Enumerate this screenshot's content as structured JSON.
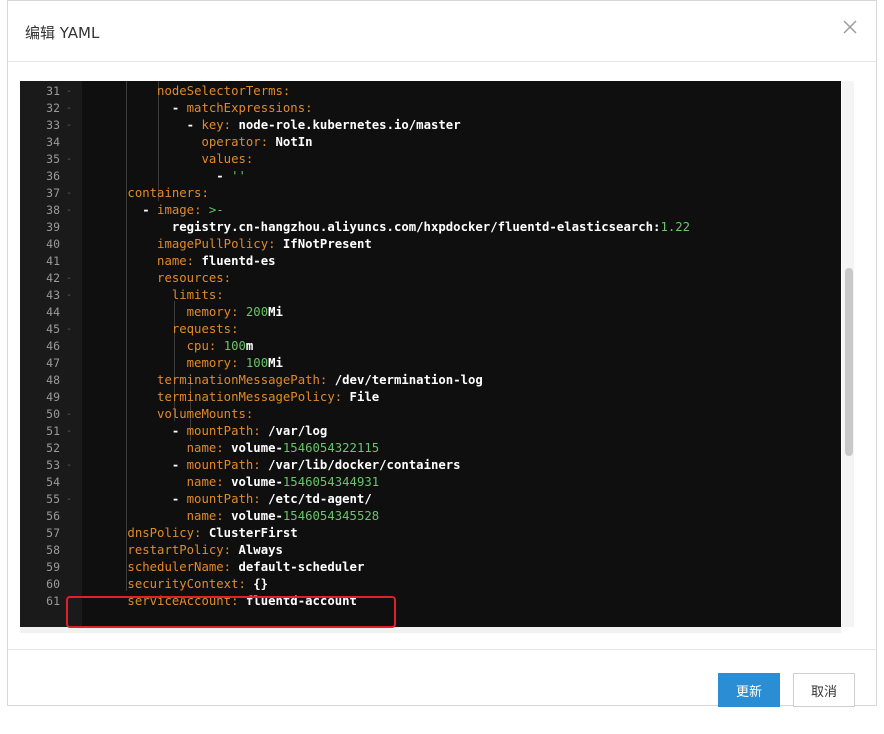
{
  "dialog": {
    "title": "编辑 YAML",
    "close_icon": "close-icon",
    "buttons": {
      "update": "更新",
      "cancel": "取消"
    }
  },
  "colors": {
    "key": "#e08a2a",
    "value": "#ffffff",
    "number": "#6ac46a",
    "primary": "#2b8ed4",
    "highlight": "#e0202a"
  },
  "editor": {
    "lines": [
      {
        "n": "31",
        "fold": true,
        "indent": "          ",
        "parts": [
          [
            "k",
            "nodeSelectorTerms:"
          ]
        ]
      },
      {
        "n": "32",
        "fold": true,
        "indent": "            ",
        "parts": [
          [
            "p",
            "- "
          ],
          [
            "k",
            "matchExpressions:"
          ]
        ]
      },
      {
        "n": "33",
        "fold": true,
        "indent": "              ",
        "parts": [
          [
            "p",
            "- "
          ],
          [
            "k",
            "key: "
          ],
          [
            "v",
            "node-role.kubernetes.io/master"
          ]
        ]
      },
      {
        "n": "34",
        "fold": false,
        "indent": "                ",
        "parts": [
          [
            "k",
            "operator: "
          ],
          [
            "v",
            "NotIn"
          ]
        ]
      },
      {
        "n": "35",
        "fold": true,
        "indent": "                ",
        "parts": [
          [
            "k",
            "values:"
          ]
        ]
      },
      {
        "n": "36",
        "fold": false,
        "indent": "                  ",
        "parts": [
          [
            "p",
            "- "
          ],
          [
            "n",
            "''"
          ]
        ]
      },
      {
        "n": "37",
        "fold": true,
        "indent": "      ",
        "parts": [
          [
            "k",
            "containers:"
          ]
        ]
      },
      {
        "n": "38",
        "fold": true,
        "indent": "        ",
        "parts": [
          [
            "p",
            "- "
          ],
          [
            "k",
            "image: "
          ],
          [
            "n",
            ">-"
          ]
        ]
      },
      {
        "n": "39",
        "fold": false,
        "indent": "            ",
        "parts": [
          [
            "v",
            "registry.cn-hangzhou.aliyuncs.com/hxpdocker/fluentd-elasticsearch:"
          ],
          [
            "n",
            "1.22"
          ]
        ]
      },
      {
        "n": "40",
        "fold": false,
        "indent": "          ",
        "parts": [
          [
            "k",
            "imagePullPolicy: "
          ],
          [
            "v",
            "IfNotPresent"
          ]
        ]
      },
      {
        "n": "41",
        "fold": false,
        "indent": "          ",
        "parts": [
          [
            "k",
            "name: "
          ],
          [
            "v",
            "fluentd-es"
          ]
        ]
      },
      {
        "n": "42",
        "fold": true,
        "indent": "          ",
        "parts": [
          [
            "k",
            "resources:"
          ]
        ]
      },
      {
        "n": "43",
        "fold": true,
        "indent": "            ",
        "parts": [
          [
            "k",
            "limits:"
          ]
        ]
      },
      {
        "n": "44",
        "fold": false,
        "indent": "              ",
        "parts": [
          [
            "k",
            "memory: "
          ],
          [
            "n",
            "200"
          ],
          [
            "v",
            "Mi"
          ]
        ]
      },
      {
        "n": "45",
        "fold": true,
        "indent": "            ",
        "parts": [
          [
            "k",
            "requests:"
          ]
        ]
      },
      {
        "n": "46",
        "fold": false,
        "indent": "              ",
        "parts": [
          [
            "k",
            "cpu: "
          ],
          [
            "n",
            "100"
          ],
          [
            "v",
            "m"
          ]
        ]
      },
      {
        "n": "47",
        "fold": false,
        "indent": "              ",
        "parts": [
          [
            "k",
            "memory: "
          ],
          [
            "n",
            "100"
          ],
          [
            "v",
            "Mi"
          ]
        ]
      },
      {
        "n": "48",
        "fold": false,
        "indent": "          ",
        "parts": [
          [
            "k",
            "terminationMessagePath: "
          ],
          [
            "v",
            "/dev/termination-log"
          ]
        ]
      },
      {
        "n": "49",
        "fold": false,
        "indent": "          ",
        "parts": [
          [
            "k",
            "terminationMessagePolicy: "
          ],
          [
            "v",
            "File"
          ]
        ]
      },
      {
        "n": "50",
        "fold": true,
        "indent": "          ",
        "parts": [
          [
            "k",
            "volumeMounts:"
          ]
        ]
      },
      {
        "n": "51",
        "fold": true,
        "indent": "            ",
        "parts": [
          [
            "p",
            "- "
          ],
          [
            "k",
            "mountPath: "
          ],
          [
            "v",
            "/var/log"
          ]
        ]
      },
      {
        "n": "52",
        "fold": false,
        "indent": "              ",
        "parts": [
          [
            "k",
            "name: "
          ],
          [
            "v",
            "volume-"
          ],
          [
            "n",
            "1546054322115"
          ]
        ]
      },
      {
        "n": "53",
        "fold": true,
        "indent": "            ",
        "parts": [
          [
            "p",
            "- "
          ],
          [
            "k",
            "mountPath: "
          ],
          [
            "v",
            "/var/lib/docker/containers"
          ]
        ]
      },
      {
        "n": "54",
        "fold": false,
        "indent": "              ",
        "parts": [
          [
            "k",
            "name: "
          ],
          [
            "v",
            "volume-"
          ],
          [
            "n",
            "1546054344931"
          ]
        ]
      },
      {
        "n": "55",
        "fold": true,
        "indent": "            ",
        "parts": [
          [
            "p",
            "- "
          ],
          [
            "k",
            "mountPath: "
          ],
          [
            "v",
            "/etc/td-agent/"
          ]
        ]
      },
      {
        "n": "56",
        "fold": false,
        "indent": "              ",
        "parts": [
          [
            "k",
            "name: "
          ],
          [
            "v",
            "volume-"
          ],
          [
            "n",
            "1546054345528"
          ]
        ]
      },
      {
        "n": "57",
        "fold": false,
        "indent": "      ",
        "parts": [
          [
            "k",
            "dnsPolicy: "
          ],
          [
            "v",
            "ClusterFirst"
          ]
        ]
      },
      {
        "n": "58",
        "fold": false,
        "indent": "      ",
        "parts": [
          [
            "k",
            "restartPolicy: "
          ],
          [
            "v",
            "Always"
          ]
        ]
      },
      {
        "n": "59",
        "fold": false,
        "indent": "      ",
        "parts": [
          [
            "k",
            "schedulerName: "
          ],
          [
            "v",
            "default-scheduler"
          ]
        ]
      },
      {
        "n": "60",
        "fold": false,
        "indent": "      ",
        "parts": [
          [
            "k",
            "securityContext: "
          ],
          [
            "v",
            "{}"
          ]
        ]
      },
      {
        "n": "61",
        "fold": false,
        "indent": "      ",
        "parts": [
          [
            "k",
            "serviceAccount: "
          ],
          [
            "v",
            "fluentd-account"
          ]
        ]
      }
    ]
  }
}
